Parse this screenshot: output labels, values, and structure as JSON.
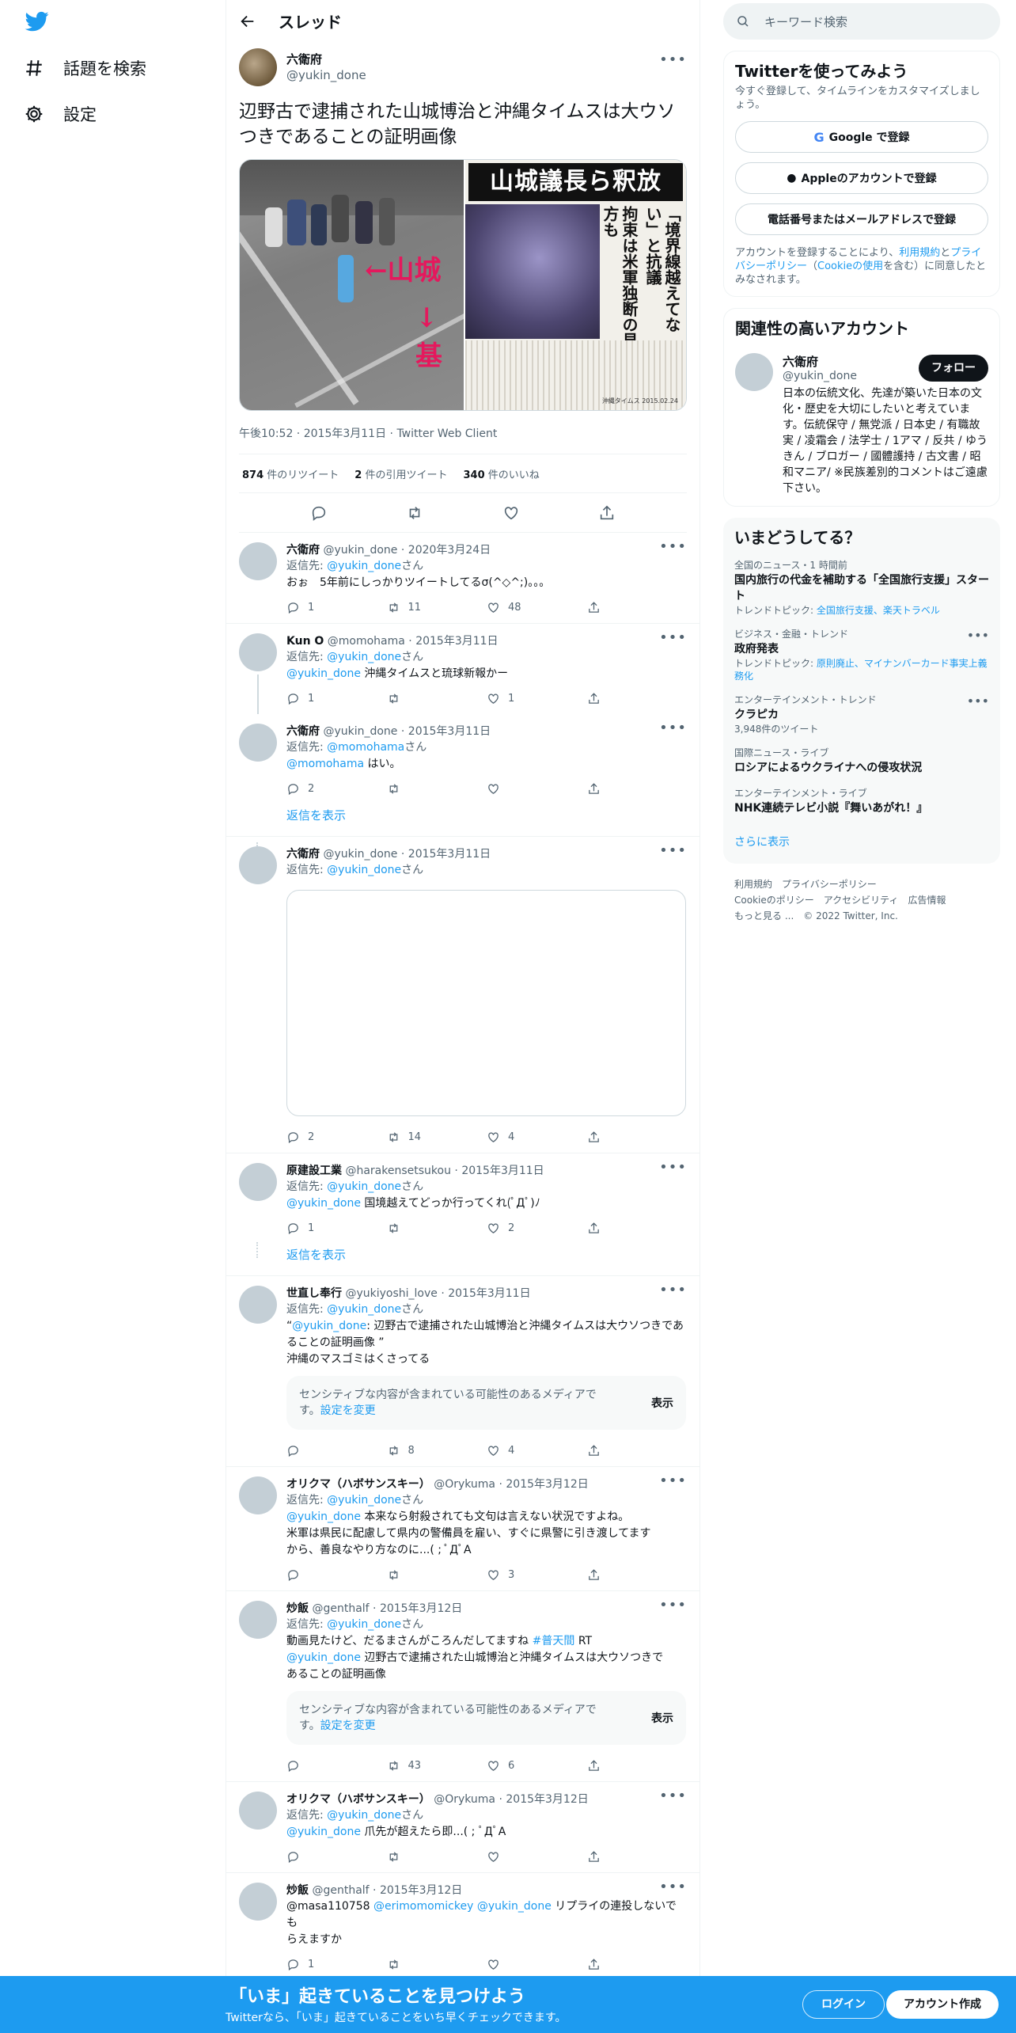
{
  "nav": {
    "items": [
      {
        "icon": "hashtag-icon",
        "label": "話題を検索"
      },
      {
        "icon": "gear-icon",
        "label": "設定"
      }
    ]
  },
  "header": {
    "title": "スレッド"
  },
  "main_tweet": {
    "name": "六衛府",
    "handle": "@yukin_done",
    "text": "辺野古で逮捕された山城博治と沖縄タイムスは大ウソつきであることの証明画像",
    "media": {
      "left_label1": "←山城",
      "left_label2": "↓基",
      "right_headline": "山城議長ら釈放",
      "right_vert1": "「境界線越えてない」と抗議",
      "right_vert2": "拘束は米軍独断の見方も",
      "right_caption": "沖縄タイムス 2015.02.24"
    },
    "time": "午後10:52",
    "date": "2015年3月11日",
    "client": "Twitter Web Client",
    "retweets": "874",
    "retweets_label": "件のリツイート",
    "quotes": "2",
    "quotes_label": "件の引用ツイート",
    "likes": "340",
    "likes_label": "件のいいね"
  },
  "replies": [
    {
      "name": "六衛府",
      "handle": "@yukin_done",
      "date": "2020年3月24日",
      "reply_to": "@yukin_done",
      "mention": "",
      "text": "おぉ　5年前にしっかりツイートしてるσ(^◇^;)。。。",
      "reply": "1",
      "rt": "11",
      "like": "48"
    },
    {
      "name": "Kun O",
      "handle": "@momohama",
      "date": "2015年3月11日",
      "reply_to": "@yukin_done",
      "mention": "@yukin_done",
      "text": " 沖縄タイムスと琉球新報かー",
      "reply": "1",
      "rt": "",
      "like": "1"
    },
    {
      "name": "六衛府",
      "handle": "@yukin_done",
      "date": "2015年3月11日",
      "reply_to": "@momohama",
      "mention": "@momohama",
      "text": " はい。",
      "reply": "2",
      "rt": "",
      "like": ""
    },
    {
      "name": "六衛府",
      "handle": "@yukin_done",
      "date": "2015年3月11日",
      "reply_to": "@yukin_done",
      "reply": "2",
      "rt": "14",
      "like": "4"
    },
    {
      "name": "原建設工業",
      "handle": "@harakensetsukou",
      "date": "2015年3月11日",
      "reply_to": "@yukin_done",
      "mention": "@yukin_done",
      "text": " 国境越えてどっか行ってくれ(ﾟДﾟ)ﾉ",
      "reply": "1",
      "rt": "",
      "like": "2"
    },
    {
      "name": "世直し奉行",
      "handle": "@yukiyoshi_love",
      "date": "2015年3月11日",
      "reply_to": "@yukin_done",
      "quote_mention": "@yukin_done",
      "text1": ": 辺野古で逮捕された山城博治と沖縄タイムスは大ウソつきであることの証明画像 ”",
      "text2": "沖縄のマスゴミはくさってる",
      "reply": "",
      "rt": "8",
      "like": "4"
    },
    {
      "name": "オリクマ（ハボサンスキー）",
      "handle": "@Orykuma",
      "date": "2015年3月12日",
      "reply_to": "@yukin_done",
      "mention": "@yukin_done",
      "text1": " 本来なら射殺されても文句は言えない状況ですよね。",
      "text2": "米軍は県民に配慮して県内の警備員を雇い、すぐに県警に引き渡してます",
      "text3": "から、善良なやり方なのに...( ; ﾟДﾟA",
      "reply": "",
      "rt": "",
      "like": "3"
    },
    {
      "name": "炒飯",
      "handle": "@genthalf",
      "date": "2015年3月12日",
      "reply_to": "@yukin_done",
      "text1": "動画見たけど、だるまさんがころんだしてますね ",
      "hashtag": "#普天間",
      "text1b": " RT",
      "mention": "@yukin_done",
      "text2": " 辺野古で逮捕された山城博治と沖縄タイムスは大ウソつきで",
      "text3": "あることの証明画像",
      "reply": "",
      "rt": "43",
      "like": "6"
    },
    {
      "name": "オリクマ（ハボサンスキー）",
      "handle": "@Orykuma",
      "date": "2015年3月12日",
      "reply_to": "@yukin_done",
      "mention": "@yukin_done",
      "text": " 爪先が超えたら即...( ; ﾟДﾟA",
      "reply": "",
      "rt": "",
      "like": ""
    },
    {
      "name": "炒飯",
      "handle": "@genthalf",
      "date": "2015年3月12日",
      "text_prefix": "@masa110758 ",
      "mention1": "@erimomomickey",
      "mention2": "@yukin_done",
      "text1": " リプライの連投しないでも",
      "text2": "らえますか",
      "reply": "1",
      "rt": "",
      "like": ""
    }
  ],
  "reply_to_label": "返信先: ",
  "reply_to_suffix": "さん",
  "show_replies": "返信を表示",
  "sensitive": {
    "text1": "センシティブな内容が含まれている可能性のあるメディアで",
    "text2": "す。",
    "link": "設定を変更",
    "button": "表示"
  },
  "right": {
    "search_placeholder": "キーワード検索",
    "signup": {
      "title": "Twitterを使ってみよう",
      "subtitle": "今すぐ登録して、タイムラインをカスタマイズしましょう。",
      "google": "Google で登録",
      "apple": "Appleのアカウントで登録",
      "phone": "電話番号またはメールアドレスで登録",
      "terms1": "アカウントを登録することにより、",
      "terms_link1": "利用規約",
      "terms2": "と",
      "terms_link2": "プライバシーポリシー",
      "terms3": "（",
      "terms_link3": "Cookieの使用",
      "terms4": "を含む）に同意したとみなされます。"
    },
    "related": {
      "title": "関連性の高いアカウント",
      "name": "六衛府",
      "handle": "@yukin_done",
      "follow": "フォロー",
      "bio": "日本の伝統文化、先達が築いた日本の文化・歴史を大切にしたいと考えています。伝統保守 / 無党派 / 日本史 / 有職故実 / 凌霜会 / 法学士 / 1アマ / 反共 / ゆうきん / ブロガー / 國體護持 / 古文書 / 昭和マニア/ ※民族差別的コメントはご遠慮下さい。"
    },
    "trends": {
      "title": "いまどうしてる？",
      "items": [
        {
          "cat": "全国のニュース・1 時間前",
          "name": "国内旅行の代金を補助する「全国旅行支援」スタート",
          "sub_prefix": "トレンドトピック: ",
          "sub_link": "全国旅行支援、楽天トラベル"
        },
        {
          "cat": "ビジネス・金融・トレンド",
          "name": "政府発表",
          "sub_prefix": "トレンドトピック: ",
          "sub_link": "原則廃止、マイナンバーカード事実上義務化"
        },
        {
          "cat": "エンターテインメント・トレンド",
          "name": "クラピカ",
          "count": "3,948件のツイート"
        },
        {
          "cat": "国際ニュース・ライブ",
          "name": "ロシアによるウクライナへの侵攻状況"
        },
        {
          "cat": "エンターテインメント・ライブ",
          "name": "NHK連続テレビ小説『舞いあがれ！』"
        }
      ],
      "more": "さらに表示"
    },
    "footer": {
      "l1": "利用規約",
      "l2": "プライバシーポリシー",
      "l3": "Cookieのポリシー",
      "l4": "アクセシビリティ",
      "l5": "広告情報",
      "l6": "もっと見る ...",
      "copyright": "© 2022 Twitter, Inc."
    }
  },
  "bottom": {
    "title": "「いま」起きていることを見つけよう",
    "subtitle": "Twitterなら、「いま」起きていることをいち早くチェックできます。",
    "login": "ログイン",
    "signup": "アカウント作成"
  },
  "colors": {
    "accent": "#1d9bf0",
    "text": "#0f1419",
    "muted": "#536471"
  }
}
